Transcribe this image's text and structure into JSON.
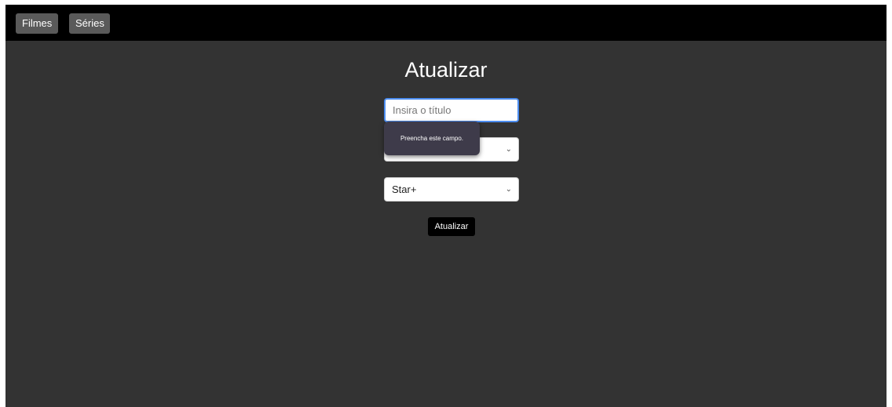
{
  "nav": {
    "filmes_label": "Filmes",
    "series_label": "Séries"
  },
  "form": {
    "title": "Atualizar",
    "title_input": {
      "value": "",
      "placeholder": "Insira o título"
    },
    "select_1": {
      "selected": ""
    },
    "select_2": {
      "selected": "Star+"
    },
    "submit_label": "Atualizar"
  },
  "tooltip": {
    "message": "Preencha este campo."
  },
  "icons": {
    "select_arrow": "chevron-down-icon"
  },
  "colors": {
    "topbar_bg": "#000000",
    "page_bg": "#333333",
    "nav_button_bg": "#5a5a5a",
    "input_focus_border": "#4c8df0",
    "submit_bg": "#000000",
    "tooltip_bg": "#3e3b4a"
  }
}
